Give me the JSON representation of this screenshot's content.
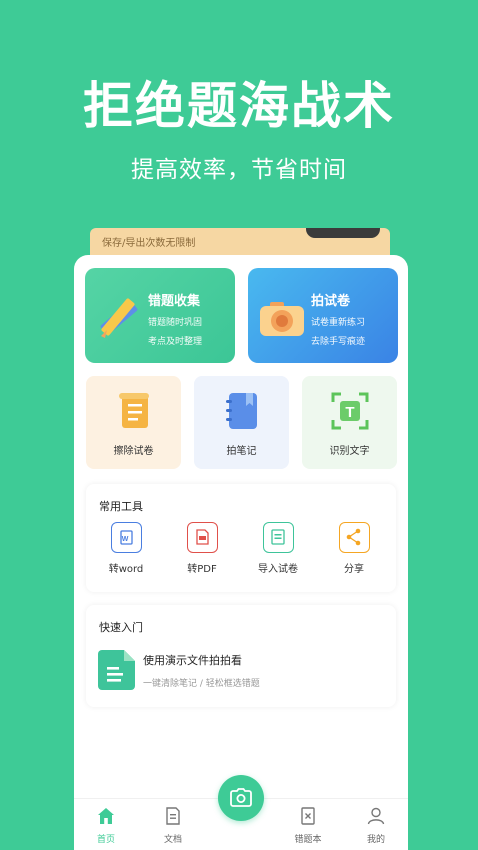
{
  "hero": {
    "title": "拒绝题海战术",
    "subtitle": "提高效率，节省时间"
  },
  "promo": {
    "text": "保存/导出次数无限制"
  },
  "feature_cards": [
    {
      "title": "错题收集",
      "line1": "错题随时巩固",
      "line2": "考点及时整理",
      "icon": "ruler-pencil-icon"
    },
    {
      "title": "拍试卷",
      "line1": "试卷重新练习",
      "line2": "去除手写痕迹",
      "icon": "camera-icon"
    }
  ],
  "tiles": [
    {
      "label": "擦除试卷",
      "icon": "scroll-icon"
    },
    {
      "label": "拍笔记",
      "icon": "notebook-icon"
    },
    {
      "label": "识别文字",
      "icon": "text-scan-icon"
    }
  ],
  "tools": {
    "title": "常用工具",
    "items": [
      {
        "label": "转word",
        "icon": "word-icon"
      },
      {
        "label": "转PDF",
        "icon": "pdf-icon"
      },
      {
        "label": "导入试卷",
        "icon": "import-icon"
      },
      {
        "label": "分享",
        "icon": "share-icon"
      }
    ]
  },
  "quick_start": {
    "title": "快速入门",
    "item_title": "使用演示文件拍拍看",
    "item_desc": "一键清除笔记 / 轻松框选错题"
  },
  "tabbar": {
    "items": [
      {
        "label": "首页",
        "icon": "home-icon",
        "active": true
      },
      {
        "label": "文档",
        "icon": "document-icon",
        "active": false
      },
      {
        "label": "错题本",
        "icon": "wrong-book-icon",
        "active": false
      },
      {
        "label": "我的",
        "icon": "user-icon",
        "active": false
      }
    ]
  },
  "colors": {
    "brand_green": "#3ecb96",
    "blue_card": "#3a83e5",
    "orange": "#f5a623"
  }
}
